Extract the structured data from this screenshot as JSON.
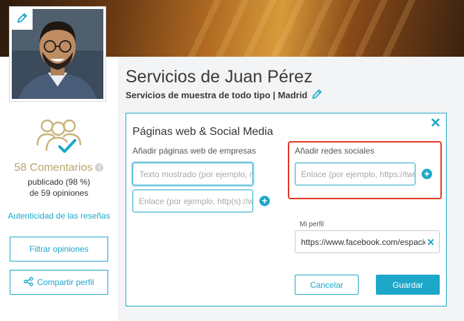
{
  "profile": {
    "title": "Servicios de Juan Pérez",
    "subtitle": "Servicios de muestra de todo tipo | Madrid"
  },
  "sidebar": {
    "reviews_count": "58 Comentarios",
    "published_line": "publicado (98 %)",
    "opinions_line": "de 59 opiniones",
    "authenticity_link": "Autenticidad de las reseñas",
    "filter_button": "Filtrar opiniones",
    "share_button": "Compartir perfil"
  },
  "modal": {
    "title": "Páginas web & Social Media",
    "websites_label": "Añadir páginas web de empresas",
    "display_text_placeholder": "Texto mostrado (por ejemplo, m",
    "link_placeholder": "Enlace (por ejemplo, http(s)://wv",
    "social_label": "Añadir redes sociales",
    "social_link_placeholder": "Enlace (por ejemplo, https://twit",
    "my_profile_label": "Mi perfil",
    "my_profile_value": "https://www.facebook.com/espacio.",
    "cancel_button": "Cancelar",
    "save_button": "Guardar"
  },
  "colors": {
    "accent": "#1da7c9",
    "gold": "#b9a46a",
    "highlight": "#e0341f"
  },
  "icons": [
    "pencil-icon",
    "reviews-verified-icon",
    "info-icon",
    "share-icon",
    "close-icon",
    "plus-icon",
    "clear-icon"
  ]
}
